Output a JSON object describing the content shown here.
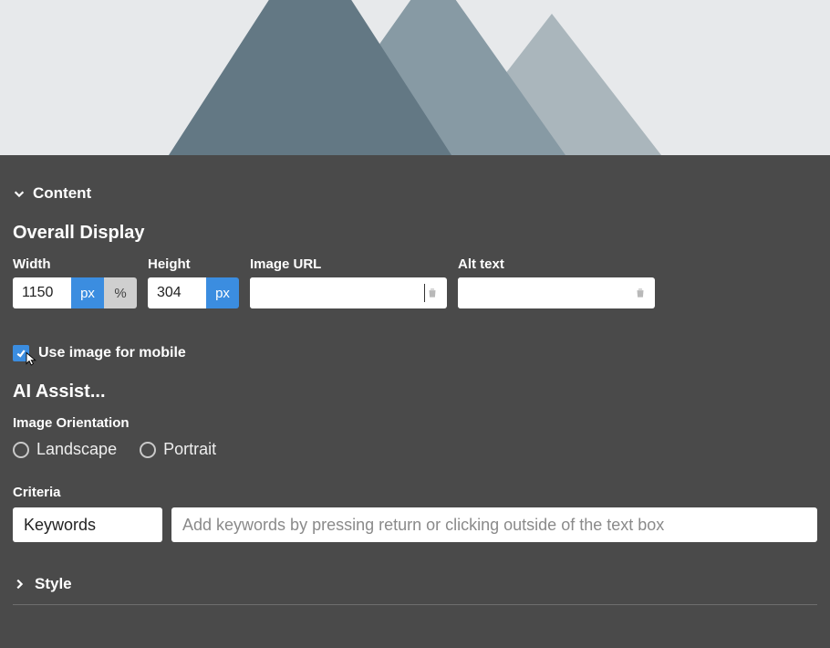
{
  "sections": {
    "content_label": "Content",
    "style_label": "Style"
  },
  "overall_display": {
    "header": "Overall Display",
    "width": {
      "label": "Width",
      "value": "1150",
      "unit_px": "px",
      "unit_pct": "%"
    },
    "height": {
      "label": "Height",
      "value": "304",
      "unit_px": "px"
    },
    "image_url": {
      "label": "Image URL",
      "value": ""
    },
    "alt_text": {
      "label": "Alt text",
      "value": ""
    }
  },
  "mobile": {
    "checkbox_label": "Use image for mobile",
    "checked": true
  },
  "ai_assist": {
    "header": "AI Assist...",
    "orientation_label": "Image Orientation",
    "landscape": "Landscape",
    "portrait": "Portrait",
    "criteria_label": "Criteria",
    "criteria_select_value": "Keywords",
    "criteria_input_placeholder": "Add keywords by pressing return or clicking outside of the text box"
  }
}
